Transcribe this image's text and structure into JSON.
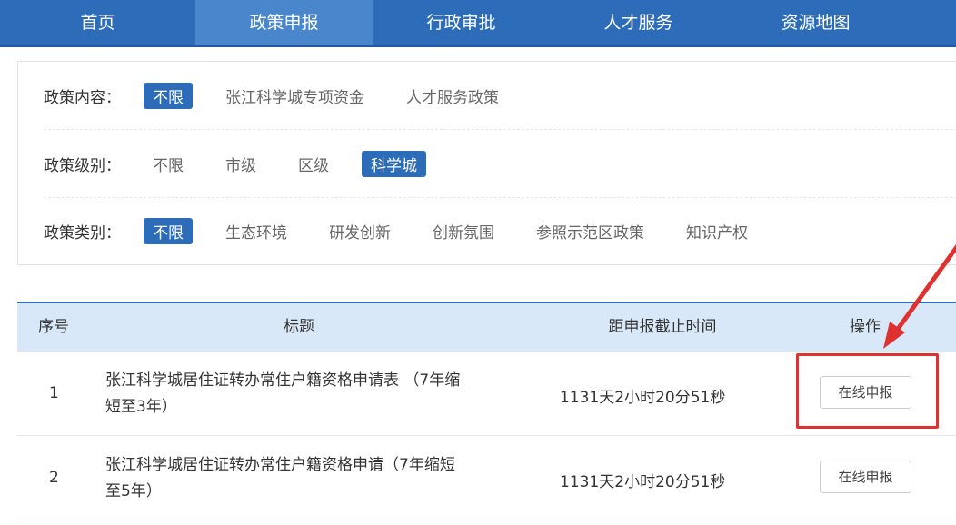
{
  "nav": {
    "items": [
      {
        "label": "首页"
      },
      {
        "label": "政策申报"
      },
      {
        "label": "行政审批"
      },
      {
        "label": "人才服务"
      },
      {
        "label": "资源地图"
      }
    ]
  },
  "filters": [
    {
      "label": "政策内容：",
      "options": [
        "不限",
        "张江科学城专项资金",
        "人才服务政策"
      ]
    },
    {
      "label": "政策级别：",
      "options": [
        "不限",
        "市级",
        "区级",
        "科学城"
      ]
    },
    {
      "label": "政策类别：",
      "options": [
        "不限",
        "生态环境",
        "研发创新",
        "创新氛围",
        "参照示范区政策",
        "知识产权"
      ]
    }
  ],
  "table": {
    "headers": [
      "序号",
      "标题",
      "距申报截止时间",
      "操作"
    ],
    "rows": [
      {
        "index": "1",
        "title_line1": "张江科学城居住证转办常住户籍资格申请表 （7年缩",
        "title_line2": "短至3年）",
        "deadline": "1131天2小时20分51秒",
        "action": "在线申报"
      },
      {
        "index": "2",
        "title_line1": "张江科学城居住证转办常住户籍资格申请（7年缩短",
        "title_line2": "至5年）",
        "deadline": "1131天2小时20分51秒",
        "action": "在线申报"
      }
    ]
  },
  "colors": {
    "nav_bg": "#2d6cb8",
    "accent": "#2d6cb8",
    "annotation": "#e03131"
  },
  "selected": {
    "nav": 1,
    "filter_0": 0,
    "filter_1": 3,
    "filter_2": 0
  }
}
